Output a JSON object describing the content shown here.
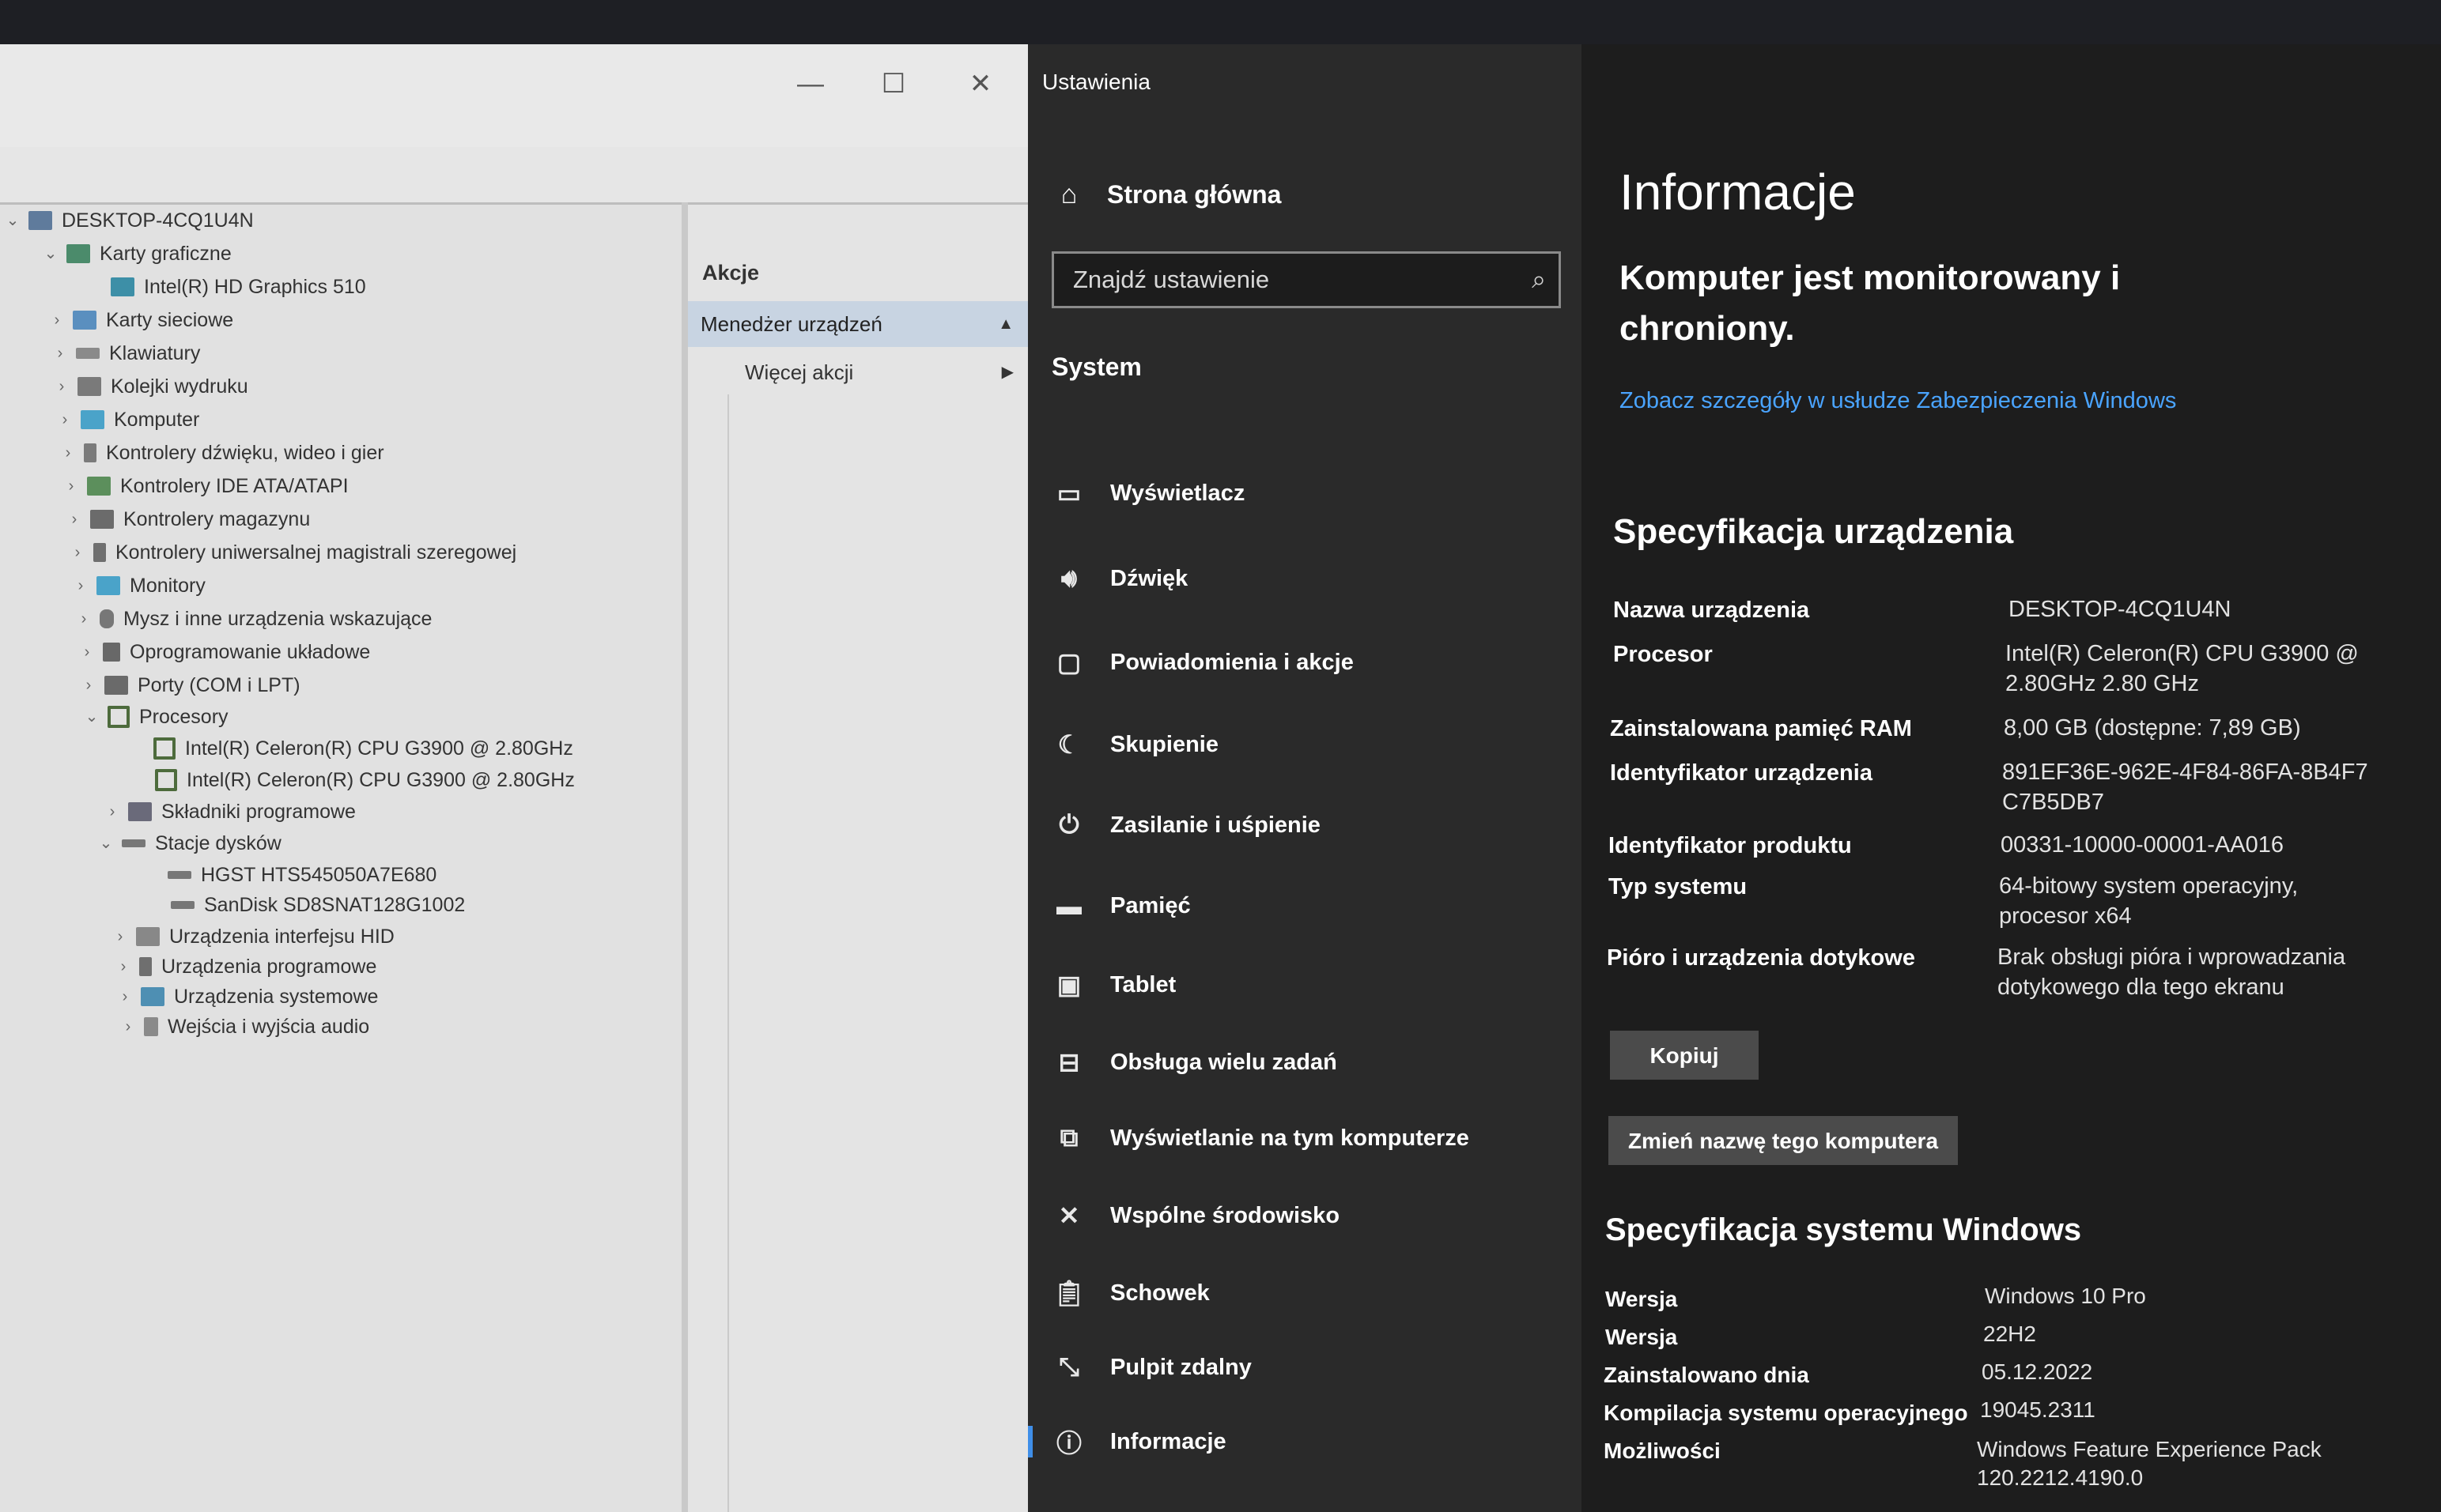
{
  "device_manager": {
    "window_controls": {
      "minimize": "—",
      "maximize": "☐",
      "close": "✕"
    },
    "tree": [
      {
        "label": "DESKTOP-4CQ1U4N",
        "level": 0,
        "expanded": true,
        "icon": "computer-icon"
      },
      {
        "label": "Karty graficzne",
        "level": 1,
        "expanded": true,
        "icon": "display-adapter-icon"
      },
      {
        "label": "Intel(R) HD Graphics 510",
        "level": 2,
        "icon": "display-adapter-icon"
      },
      {
        "label": "Karty sieciowe",
        "level": 1,
        "icon": "network-adapter-icon"
      },
      {
        "label": "Klawiatury",
        "level": 1,
        "icon": "keyboard-icon"
      },
      {
        "label": "Kolejki wydruku",
        "level": 1,
        "icon": "printer-icon"
      },
      {
        "label": "Komputer",
        "level": 1,
        "icon": "monitor-icon"
      },
      {
        "label": "Kontrolery dźwięku, wideo i gier",
        "level": 1,
        "icon": "sound-icon"
      },
      {
        "label": "Kontrolery IDE ATA/ATAPI",
        "level": 1,
        "icon": "ide-icon"
      },
      {
        "label": "Kontrolery magazynu",
        "level": 1,
        "icon": "storage-icon"
      },
      {
        "label": "Kontrolery uniwersalnej magistrali szeregowej",
        "level": 1,
        "icon": "usb-icon"
      },
      {
        "label": "Monitory",
        "level": 1,
        "icon": "monitor-icon"
      },
      {
        "label": "Mysz i inne urządzenia wskazujące",
        "level": 1,
        "icon": "mouse-icon"
      },
      {
        "label": "Oprogramowanie układowe",
        "level": 1,
        "icon": "firmware-icon"
      },
      {
        "label": "Porty (COM i LPT)",
        "level": 1,
        "icon": "port-icon"
      },
      {
        "label": "Procesory",
        "level": 1,
        "expanded": true,
        "icon": "processor-icon"
      },
      {
        "label": "Intel(R) Celeron(R) CPU G3900 @ 2.80GHz",
        "level": 2,
        "icon": "processor-icon"
      },
      {
        "label": "Intel(R) Celeron(R) CPU G3900 @ 2.80GHz",
        "level": 2,
        "icon": "processor-icon"
      },
      {
        "label": "Składniki programowe",
        "level": 1,
        "icon": "software-component-icon"
      },
      {
        "label": "Stacje dysków",
        "level": 1,
        "expanded": true,
        "icon": "disk-drive-icon"
      },
      {
        "label": "HGST HTS545050A7E680",
        "level": 2,
        "icon": "disk-drive-icon"
      },
      {
        "label": "SanDisk SD8SNAT128G1002",
        "level": 2,
        "icon": "disk-drive-icon"
      },
      {
        "label": "Urządzenia interfejsu HID",
        "level": 1,
        "icon": "hid-icon"
      },
      {
        "label": "Urządzenia programowe",
        "level": 1,
        "icon": "software-device-icon"
      },
      {
        "label": "Urządzenia systemowe",
        "level": 1,
        "icon": "system-device-icon"
      },
      {
        "label": "Wejścia i wyjścia audio",
        "level": 1,
        "icon": "audio-io-icon"
      }
    ],
    "actions": {
      "header": "Akcje",
      "selected": "Menedżer urządzeń",
      "more": "Więcej akcji"
    }
  },
  "settings": {
    "window_title": "Ustawienia",
    "home_label": "Strona główna",
    "search_placeholder": "Znajdź ustawienie",
    "section_label": "System",
    "nav_items": [
      {
        "label": "Wyświetlacz",
        "icon": "display-icon",
        "glyph": "▭"
      },
      {
        "label": "Dźwięk",
        "icon": "speaker-icon",
        "glyph": "🔊︎"
      },
      {
        "label": "Powiadomienia i akcje",
        "icon": "notification-icon",
        "glyph": "▢"
      },
      {
        "label": "Skupienie",
        "icon": "moon-icon",
        "glyph": "☾"
      },
      {
        "label": "Zasilanie i uśpienie",
        "icon": "power-icon",
        "glyph": "⏻"
      },
      {
        "label": "Pamięć",
        "icon": "storage-icon",
        "glyph": "▬"
      },
      {
        "label": "Tablet",
        "icon": "tablet-icon",
        "glyph": "▣"
      },
      {
        "label": "Obsługa wielu zadań",
        "icon": "multitasking-icon",
        "glyph": "⊟"
      },
      {
        "label": "Wyświetlanie na tym komputerze",
        "icon": "projecting-icon",
        "glyph": "⧉"
      },
      {
        "label": "Wspólne środowisko",
        "icon": "shared-experiences-icon",
        "glyph": "✕"
      },
      {
        "label": "Schowek",
        "icon": "clipboard-icon",
        "glyph": "📋︎"
      },
      {
        "label": "Pulpit zdalny",
        "icon": "remote-desktop-icon",
        "glyph": "⤡"
      },
      {
        "label": "Informacje",
        "icon": "info-icon",
        "glyph": "ⓘ",
        "active": true
      }
    ],
    "about": {
      "title": "Informacje",
      "protection": "Komputer jest monitorowany i chroniony.",
      "security_link": "Zobacz szczegóły w usłudze Zabezpieczenia Windows",
      "device_spec_title": "Specyfikacja urządzenia",
      "device_spec": [
        {
          "key": "Nazwa urządzenia",
          "value": "DESKTOP-4CQ1U4N"
        },
        {
          "key": "Procesor",
          "value": "Intel(R) Celeron(R) CPU G3900 @ 2.80GHz   2.80 GHz"
        },
        {
          "key": "Zainstalowana pamięć RAM",
          "value": "8,00 GB (dostępne: 7,89 GB)"
        },
        {
          "key": "Identyfikator urządzenia",
          "value": "891EF36E-962E-4F84-86FA-8B4F7C7B5DB7"
        },
        {
          "key": "Identyfikator produktu",
          "value": "00331-10000-00001-AA016"
        },
        {
          "key": "Typ systemu",
          "value": "64-bitowy system operacyjny, procesor x64"
        },
        {
          "key": "Pióro i urządzenia dotykowe",
          "value": "Brak obsługi pióra i wprowadzania dotykowego dla tego ekranu"
        }
      ],
      "copy_button": "Kopiuj",
      "rename_button": "Zmień nazwę tego komputera",
      "windows_spec_title": "Specyfikacja systemu Windows",
      "windows_spec": [
        {
          "key": "Wersja",
          "value": "Windows 10 Pro"
        },
        {
          "key": "Wersja",
          "value": "22H2"
        },
        {
          "key": "Zainstalowano dnia",
          "value": "05.12.2022"
        },
        {
          "key": "Kompilacja systemu operacyjnego",
          "value": "19045.2311"
        },
        {
          "key": "Możliwości",
          "value": "Windows Feature Experience Pack 120.2212.4190.0"
        }
      ]
    }
  }
}
